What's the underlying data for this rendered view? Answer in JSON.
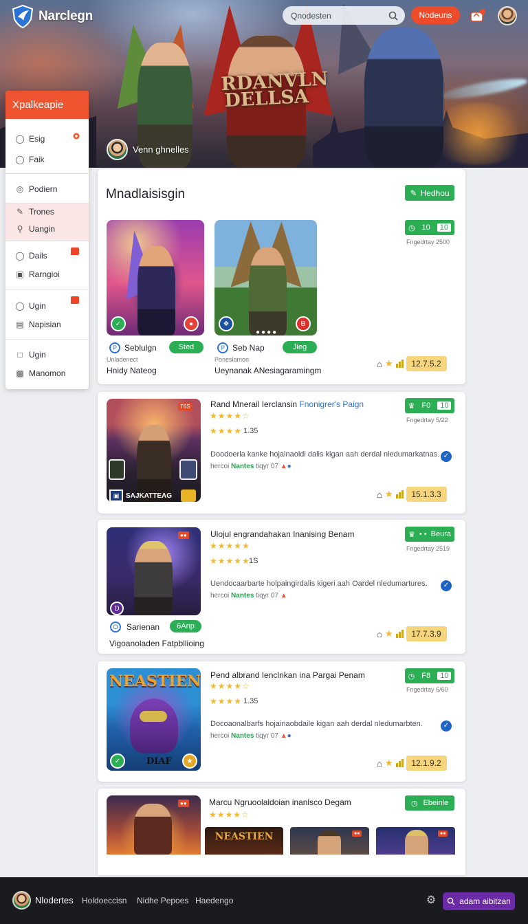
{
  "header": {
    "brand": "Narclegn",
    "search_placeholder": "Qnodesten",
    "signup_label": "Nodeuns"
  },
  "hero": {
    "art_title": "RDANVLN DELLSA",
    "user_name": "Venn ghnelles"
  },
  "sidebar": {
    "title": "Xpalkeapie",
    "items": [
      {
        "label": "Esig",
        "icon": "user-icon"
      },
      {
        "label": "Faik",
        "icon": "user-icon"
      },
      {
        "label": "Podiern",
        "icon": "circle-icon"
      },
      {
        "label": "Trones",
        "icon": "pen-icon"
      },
      {
        "label": "Uangin",
        "icon": "search-icon"
      },
      {
        "label": "Dails",
        "icon": "user-icon"
      },
      {
        "label": "Rarngioi",
        "icon": "image-icon"
      },
      {
        "label": "Ugin",
        "icon": "user-icon"
      },
      {
        "label": "Napisian",
        "icon": "file-icon"
      },
      {
        "label": "Ugin",
        "icon": "doc-icon"
      },
      {
        "label": "Manomon",
        "icon": "gift-icon"
      }
    ]
  },
  "feature": {
    "heading": "Mnadlaisisgin",
    "button": "Hedhou",
    "score_pill": {
      "left": "10",
      "right": "10"
    },
    "date": "Fngedrtay 2500",
    "games": [
      {
        "name": "Seblulgn",
        "tag": "Sted",
        "sub": "Unladenect",
        "caption": "Hnidy Nateog"
      },
      {
        "name": "Seb Nap",
        "tag": "Jieg",
        "sub": "Poneslamon",
        "caption": "Ueynanak ANesiagaramingm"
      }
    ],
    "rating": "12.7.5.2"
  },
  "listings": [
    {
      "title": "Rand Mnerail Ierclansin",
      "title_accent": "Fnonigrer's Paign",
      "pill_left": "F0",
      "pill_right": "10",
      "date": "Fngedrtay 5/22",
      "rating_text": "1.35",
      "description": "Doodoerla kanke hojainaoldi dalis kigan aah derdal nledumarkatnas.",
      "meta_prefix": "hercoi",
      "meta_green": "Nantes",
      "meta_suffix": "tiqyr 07",
      "art_corner": "T6S",
      "art_caption": "SAJKATTEAG",
      "score": "15.1.3.3"
    },
    {
      "title": "Ulojul engrandahakan Inanising Benam",
      "title_accent": "",
      "pill_left": "",
      "pill_right": "Beura",
      "date": "Fngedrtay 2519",
      "rating_text": "1S",
      "description": "Uendocaarbarte holpaingirdalis kigeri aah Oardel nledumartures.",
      "meta_prefix": "hercoi",
      "meta_green": "Nantes",
      "meta_suffix": "tiqyr 07",
      "user_name": "Sarienan",
      "user_tag": "6Anp",
      "caption": "Vigoanoladen Fatpbllioing",
      "score": "17.7.3.9"
    },
    {
      "title": "Pend albrand Ienclnkan ina Pargai Penam",
      "title_accent": "",
      "pill_left": "F8",
      "pill_right": "10",
      "date": "Fngedrtay 6/60",
      "rating_text": "1.35",
      "description": "Docoaonalbarfs hojainaobdaile kigan aah derdal nledumarbten.",
      "meta_prefix": "hercoi",
      "meta_green": "Nantes",
      "meta_suffix": "tiqyr 07",
      "art_title": "NEASTIEN",
      "art_caption": "DIAF",
      "score": "12.1.9.2"
    },
    {
      "title": "Marcu Ngruoolaldoian inanlsco Degam",
      "pill_right": "Ebeinle",
      "thumbs_title": "NEASTIEN"
    }
  ],
  "bottombar": {
    "brand": "Nlodertes",
    "links": [
      "Holdoeccisn",
      "Nidhe Pepoes",
      "Haedengo"
    ],
    "cta": "adam aibitzan"
  },
  "colors": {
    "accent": "#ee4b2b",
    "green": "#2cae55",
    "amber": "#f6d57c",
    "purple": "#6b2aa6"
  }
}
